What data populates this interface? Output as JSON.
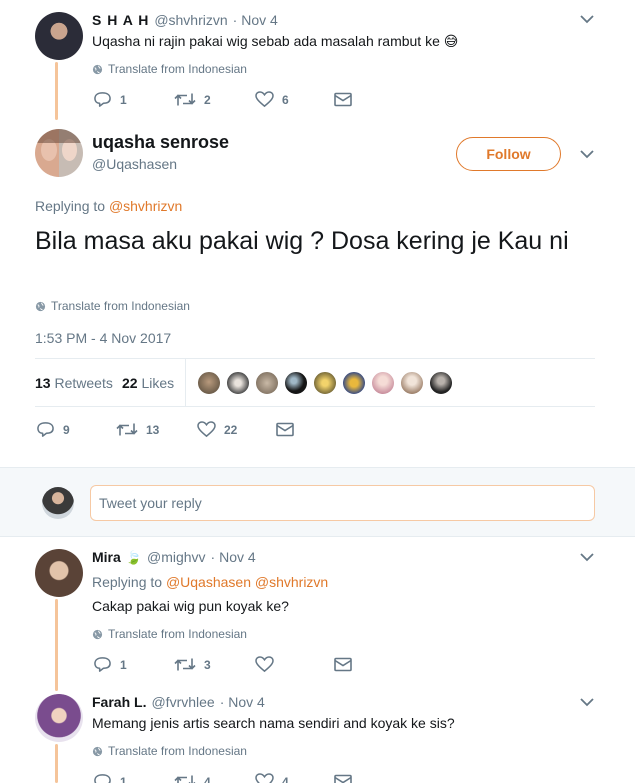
{
  "tweet1": {
    "name": "S H A H",
    "handle": "@shvhrizvn",
    "date": "· Nov 4",
    "text": "Uqasha ni rajin pakai wig sebab ada masalah rambut ke 😅",
    "translate": "Translate from Indonesian",
    "replies": "1",
    "retweets": "2",
    "likes": "6"
  },
  "main": {
    "name": "uqasha senrose",
    "handle": "@Uqashasen",
    "follow_label": "Follow",
    "replying_label": "Replying to",
    "replying_to": "@shvhrizvn",
    "text": "Bila masa aku pakai wig ? Dosa kering je Kau ni",
    "translate": "Translate from Indonesian",
    "timestamp": "1:53 PM - 4 Nov 2017",
    "retweet_count": "13",
    "retweet_label": "Retweets",
    "like_count": "22",
    "like_label": "Likes",
    "replies": "9",
    "retweets": "13",
    "likes": "22"
  },
  "reply_box": {
    "placeholder": "Tweet your reply"
  },
  "tweet3": {
    "name": "Mira",
    "emoji": "🍃",
    "handle": "@mighvv",
    "date": "· Nov 4",
    "replying_label": "Replying to",
    "replying_to": "@Uqashasen @shvhrizvn",
    "text": "Cakap pakai wig pun koyak ke?",
    "translate": "Translate from Indonesian",
    "replies": "1",
    "retweets": "3"
  },
  "tweet4": {
    "name": "Farah L.",
    "handle": "@fvrvhlee",
    "date": "· Nov 4",
    "text": "Memang jenis artis search nama sendiri and koyak ke sis?",
    "translate": "Translate from Indonesian",
    "replies": "1",
    "retweets": "4",
    "likes": "4"
  },
  "colors": {
    "accent": "#e0792b",
    "thread_line": "#f5c49a",
    "muted": "#657786"
  }
}
